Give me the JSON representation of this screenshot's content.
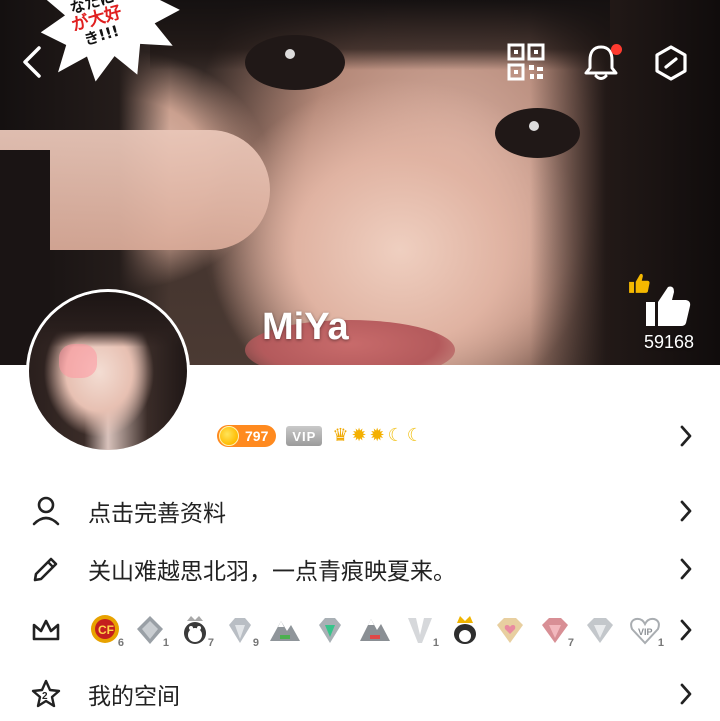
{
  "header": {
    "back_icon": "chevron-left-icon",
    "qr_icon": "qr-code-icon",
    "bell_icon": "bell-icon",
    "settings_icon": "hexagon-settings-icon",
    "bell_has_dot": true,
    "sticker_lines": [
      "なたに",
      "が大好",
      "き!!!"
    ]
  },
  "profile": {
    "nickname": "MiYa",
    "likes": "59168",
    "like_icon": "thumbs-up-icon",
    "coins": "797",
    "vip_label": "VIP",
    "level_icons": [
      "crown-icon",
      "sun-icon",
      "sun-icon",
      "moon-icon",
      "moon-icon"
    ]
  },
  "rows": {
    "edit_profile": {
      "label": "点击完善资料",
      "icon": "user-icon"
    },
    "signature": {
      "label": "关山难越思北羽，一点青痕映夏来。",
      "icon": "pencil-icon"
    },
    "medals": {
      "icon": "crown-outline-icon",
      "items": [
        {
          "name": "cf-medal",
          "num": "6"
        },
        {
          "name": "rank-medal-1",
          "num": "1"
        },
        {
          "name": "penguin-medal",
          "num": "7"
        },
        {
          "name": "diamond-medal",
          "num": "9"
        },
        {
          "name": "mountain-medal",
          "num": ""
        },
        {
          "name": "emerald-medal",
          "num": ""
        },
        {
          "name": "mountain-medal-2",
          "num": ""
        },
        {
          "name": "v-medal",
          "num": "1"
        },
        {
          "name": "penguin-crown-medal",
          "num": ""
        },
        {
          "name": "heart-gem-medal",
          "num": ""
        },
        {
          "name": "ruby-medal",
          "num": "7"
        },
        {
          "name": "silver-gem-medal",
          "num": ""
        },
        {
          "name": "vip-heart-medal",
          "num": "1"
        }
      ]
    },
    "space": {
      "label": "我的空间",
      "icon": "star-outline-icon"
    }
  },
  "colors": {
    "accent": "#ff8a1f",
    "notification": "#ff3b30",
    "text": "#222222"
  }
}
